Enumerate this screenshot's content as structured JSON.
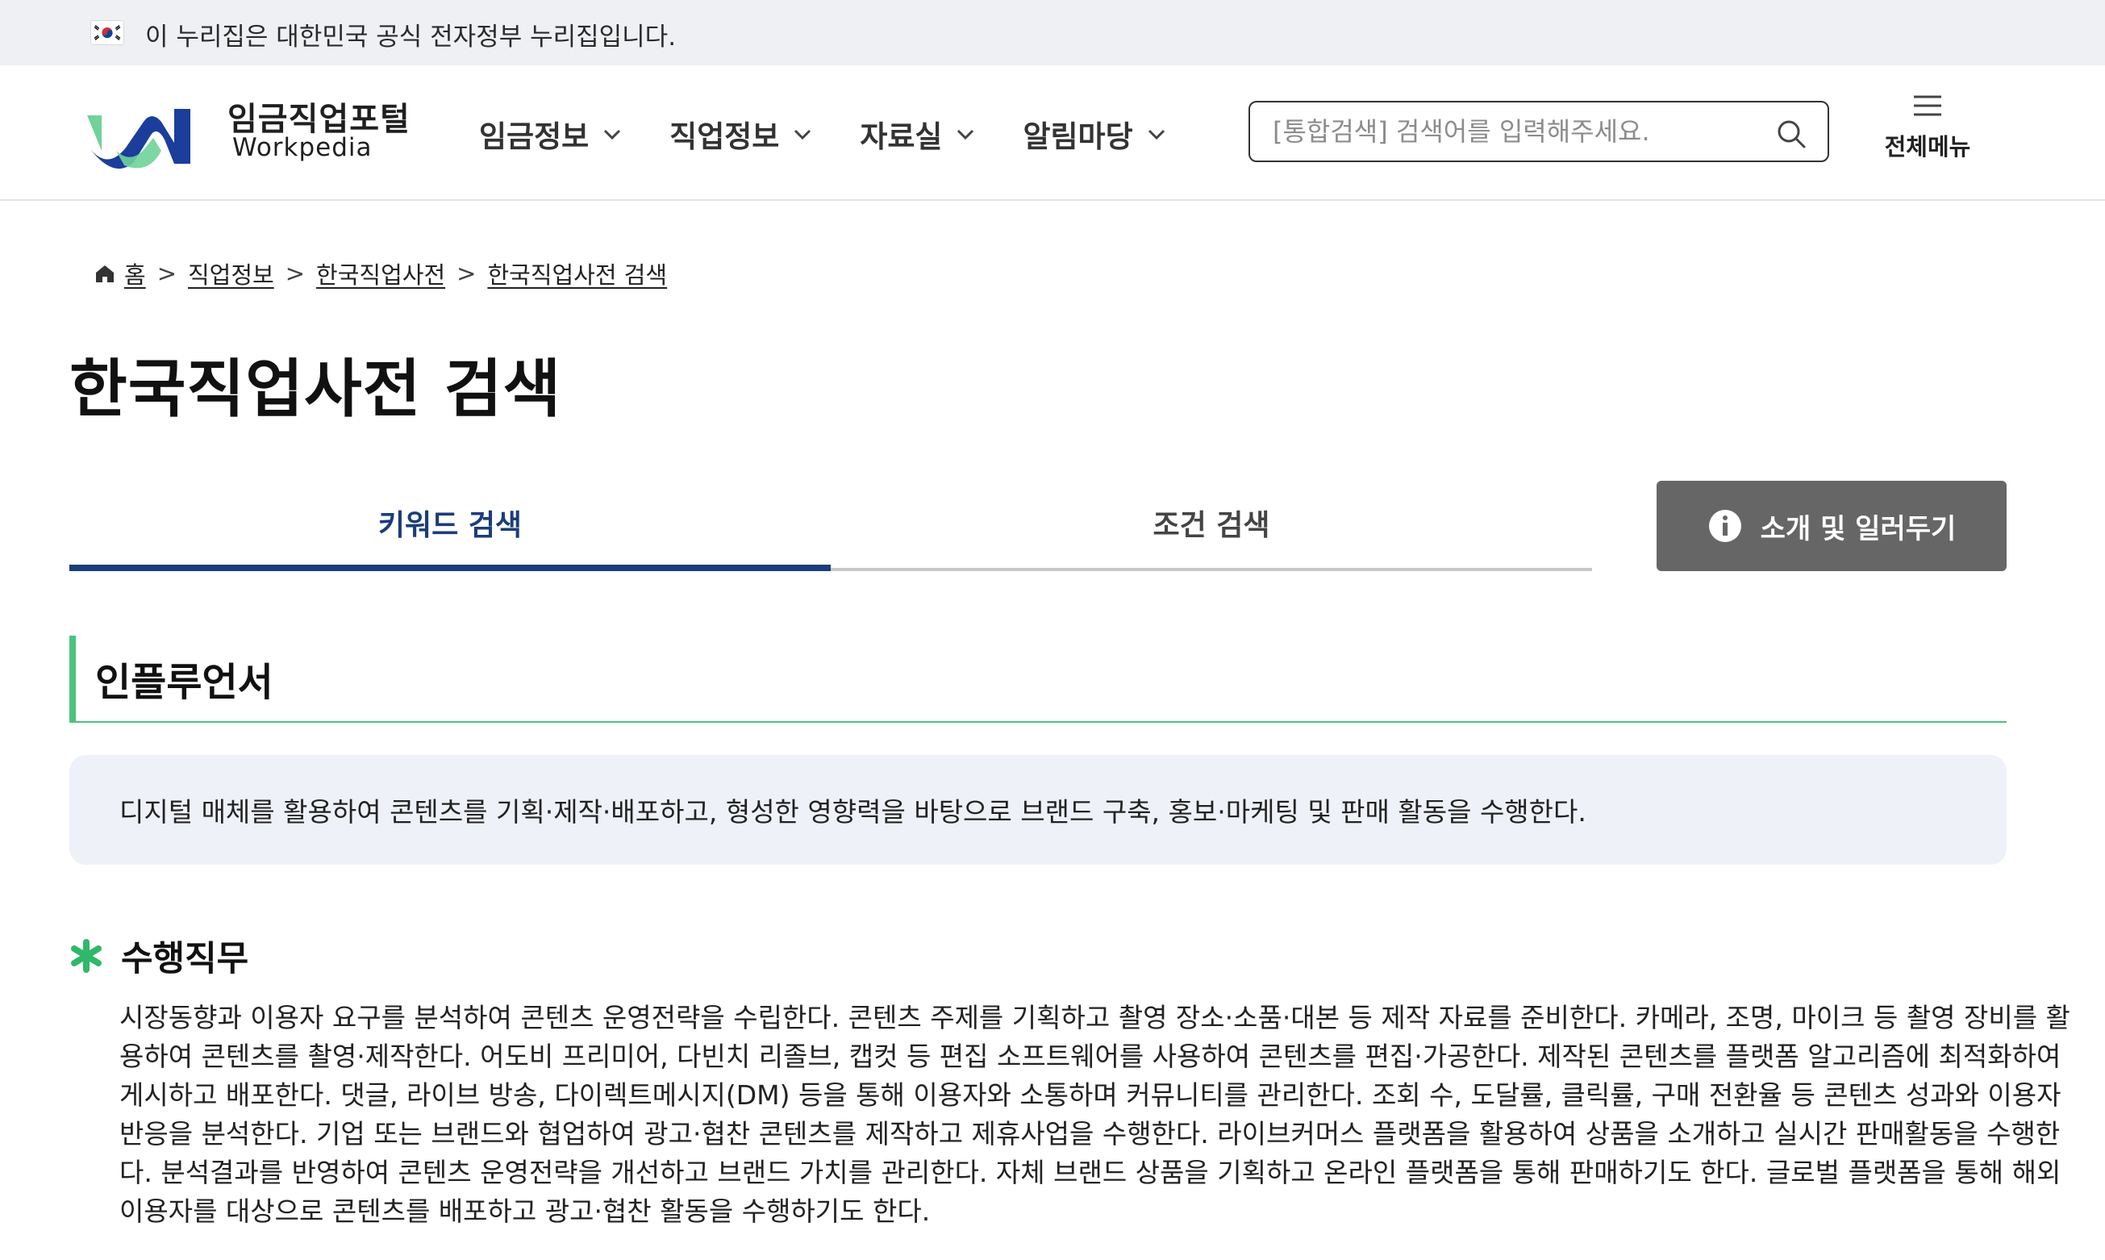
{
  "gov_banner": {
    "text": "이 누리집은 대한민국 공식 전자정부 누리집입니다.",
    "flag_icon": "korea-flag-icon"
  },
  "header": {
    "logo_kr": "임금직업포털",
    "logo_en": "Workpedia",
    "logo_colors": {
      "green": "#6fd39a",
      "navy": "#1b3d9c"
    },
    "nav": [
      {
        "label": "임금정보"
      },
      {
        "label": "직업정보"
      },
      {
        "label": "자료실"
      },
      {
        "label": "알림마당"
      }
    ],
    "search": {
      "placeholder": "[통합검색] 검색어를 입력해주세요.",
      "value": ""
    },
    "all_menu_label": "전체메뉴"
  },
  "breadcrumb": {
    "home": "홈",
    "items": [
      "직업정보",
      "한국직업사전",
      "한국직업사전 검색"
    ]
  },
  "page_title": "한국직업사전 검색",
  "tabs": [
    {
      "label": "키워드 검색",
      "active": true
    },
    {
      "label": "조건 검색",
      "active": false
    }
  ],
  "intro_button": {
    "label": "소개 및 일러두기"
  },
  "job": {
    "title": "인플루언서",
    "summary": "디지털 매체를 활용하여 콘텐츠를 기획·제작·배포하고, 형성한 영향력을 바탕으로 브랜드 구축, 홍보·마케팅 및 판매 활동을 수행한다.",
    "duties_title": "수행직무",
    "duties_lines": [
      "시장동향과 이용자 요구를 분석하여 콘텐츠 운영전략을 수립한다. 콘텐츠 주제를 기획하고 촬영 장소·소품·대본 등 제작 자료를 준비한다. 카메라, 조명, 마이크 등 촬영 장비를 활",
      "용하여 콘텐츠를 촬영·제작한다. 어도비 프리미어, 다빈치 리졸브, 캡컷 등 편집 소프트웨어를 사용하여 콘텐츠를 편집·가공한다. 제작된 콘텐츠를 플랫폼 알고리즘에 최적화하여",
      "게시하고 배포한다. 댓글, 라이브 방송, 다이렉트메시지(DM) 등을 통해 이용자와 소통하며 커뮤니티를 관리한다. 조회 수, 도달률, 클릭률, 구매 전환율 등 콘텐츠 성과와 이용자",
      "반응을 분석한다. 기업 또는 브랜드와 협업하여 광고·협찬 콘텐츠를 제작하고 제휴사업을 수행한다. 라이브커머스 플랫폼을 활용하여 상품을 소개하고 실시간 판매활동을 수행한",
      "다. 분석결과를 반영하여 콘텐츠 운영전략을 개선하고 브랜드 가치를 관리한다. 자체 브랜드 상품을 기획하고 온라인 플랫폼을 통해 판매하기도 한다. 글로벌 플랫폼을 통해 해외",
      "이용자를 대상으로 콘텐츠를 배포하고 광고·협찬 활동을 수행하기도 한다."
    ]
  },
  "colors": {
    "primary_navy": "#1b3d79",
    "accent_green": "#4cc37c",
    "button_gray": "#666666",
    "summary_bg": "#eef1f7",
    "banner_bg": "#eef0f4"
  }
}
